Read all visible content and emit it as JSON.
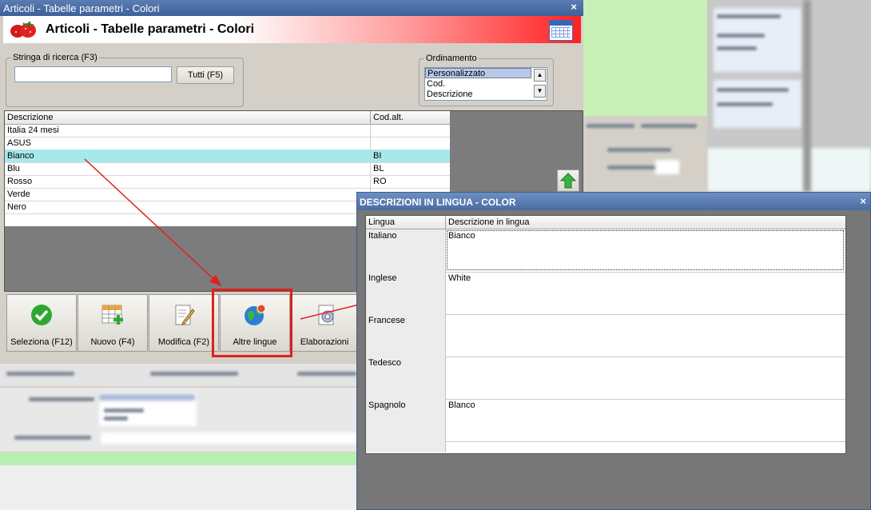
{
  "main_window": {
    "title": "Articoli - Tabelle parametri - Colori",
    "header_title": "Articoli - Tabelle parametri - Colori",
    "close": "×"
  },
  "search": {
    "legend": "Stringa di ricerca (F3)",
    "value": "",
    "all_button": "Tutti (F5)"
  },
  "ordering": {
    "legend": "Ordinamento",
    "options": [
      "Personalizzato",
      "Cod.",
      "Descrizione"
    ],
    "selected": "Personalizzato"
  },
  "grid": {
    "headers": [
      "Descrizione",
      "Cod.alt."
    ],
    "rows": [
      {
        "desc": "Italia 24 mesi",
        "code": ""
      },
      {
        "desc": "ASUS",
        "code": ""
      },
      {
        "desc": "Bianco",
        "code": "BI"
      },
      {
        "desc": "Blu",
        "code": "BL"
      },
      {
        "desc": "Rosso",
        "code": "RO"
      },
      {
        "desc": "Verde",
        "code": ""
      },
      {
        "desc": "Nero",
        "code": ""
      }
    ],
    "selected_index": 2
  },
  "toolbar": {
    "select": "Seleziona (F12)",
    "new": "Nuovo (F4)",
    "edit": "Modifica (F2)",
    "languages": "Altre lingue",
    "processing": "Elaborazioni"
  },
  "lang_window": {
    "title": "DESCRIZIONI IN LINGUA - COLOR",
    "close": "×",
    "headers": [
      "Lingua",
      "Descrizione in lingua"
    ],
    "rows": [
      {
        "lang": "Italiano",
        "desc": "Bianco"
      },
      {
        "lang": "Inglese",
        "desc": "White"
      },
      {
        "lang": "Francese",
        "desc": ""
      },
      {
        "lang": "Tedesco",
        "desc": ""
      },
      {
        "lang": "Spagnolo",
        "desc": "Blanco"
      }
    ]
  },
  "colors": {
    "selected_row": "#a6e9ec",
    "highlight_border": "#e02020",
    "arrow": "#e02020"
  },
  "icons": {
    "select": "check-icon",
    "new": "grid-add-icon",
    "edit": "edit-document-icon",
    "languages": "globe-icon",
    "processing": "gear-document-icon",
    "up": "arrow-up-icon"
  }
}
